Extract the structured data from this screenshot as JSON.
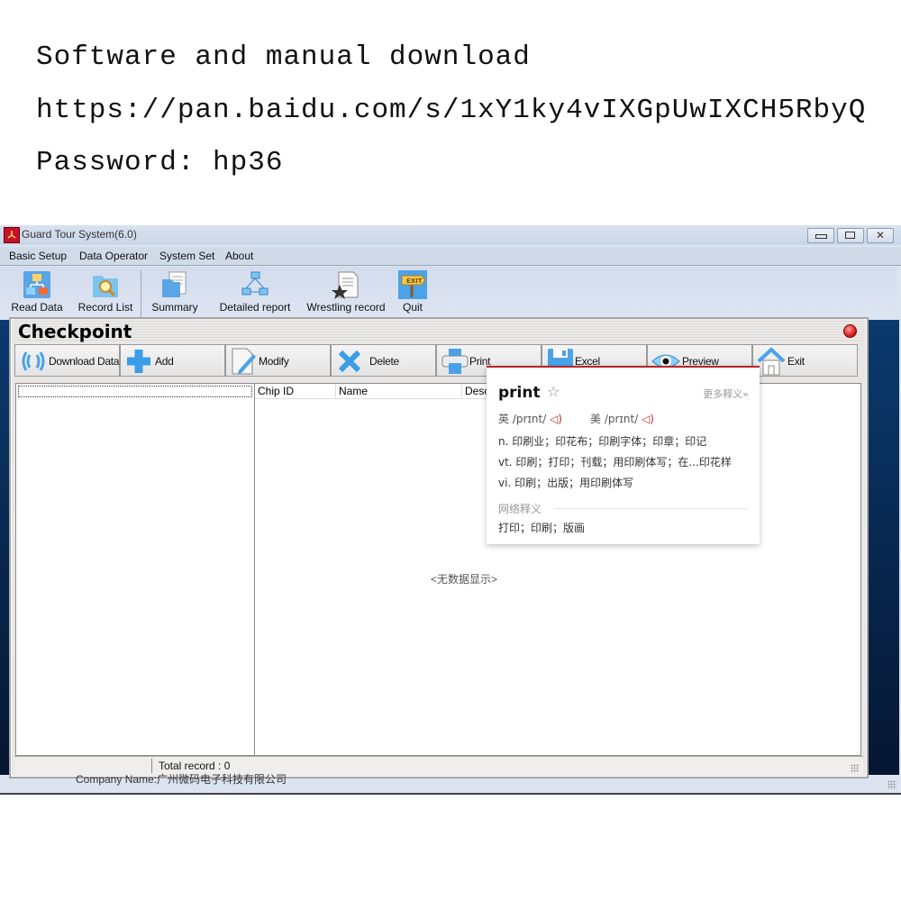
{
  "promo": {
    "line1": "Software and manual download",
    "line2": "https://pan.baidu.com/s/1xY1ky4vIXGpUwIXCH5RbyQ",
    "line3": "Password: hp36"
  },
  "window": {
    "title": "Guard Tour System(6.0)",
    "controls": {
      "minimize": "minimize-icon",
      "maximize": "maximize-icon",
      "close": "close-icon"
    }
  },
  "menu": [
    {
      "label": "Basic Setup"
    },
    {
      "label": "Data Operator"
    },
    {
      "label": "System Set"
    },
    {
      "label": "About"
    }
  ],
  "toolbar": [
    {
      "label": "Read Data",
      "icon": "hierarchy-icon"
    },
    {
      "label": "Record List",
      "icon": "folder-search-icon"
    },
    {
      "label": "Summary",
      "icon": "folder-document-icon"
    },
    {
      "label": "Detailed report",
      "icon": "network-icon"
    },
    {
      "label": "Wrestling record",
      "icon": "document-star-icon"
    },
    {
      "label": "Quit",
      "icon": "exit-sign-icon"
    }
  ],
  "child": {
    "title": "Checkpoint",
    "buttons": [
      {
        "label": "Download Data",
        "icon": "wireless-icon"
      },
      {
        "label": "Add",
        "icon": "plus-icon"
      },
      {
        "label": "Modify",
        "icon": "edit-icon"
      },
      {
        "label": "Delete",
        "icon": "delete-x-icon"
      },
      {
        "label": "Print",
        "icon": "printer-icon"
      },
      {
        "label": "Excel",
        "icon": "save-icon"
      },
      {
        "label": "Preview",
        "icon": "eye-icon"
      },
      {
        "label": "Exit",
        "icon": "home-icon"
      }
    ],
    "columns": [
      "Chip ID",
      "Name",
      "Desc"
    ],
    "empty_message": "<无数据显示>",
    "status": "Total record : 0"
  },
  "company": "Company Name:广州微码电子科技有限公司",
  "dictionary": {
    "word": "print",
    "more": "更多释义»",
    "uk_label": "英",
    "uk_phonetic": "/prɪnt/",
    "us_label": "美",
    "us_phonetic": "/prɪnt/",
    "definitions": [
      "n. 印刷业；印花布；印刷字体；印章；印记",
      "vt. 印刷；打印；刊载；用印刷体写；在...印花样",
      "vi. 印刷；出版；用印刷体写"
    ],
    "web_heading": "网络释义",
    "web_definition": "打印；印刷；版画"
  },
  "colors": {
    "accent_red": "#b5262b",
    "desktop_blue": "#0b3a6e"
  }
}
